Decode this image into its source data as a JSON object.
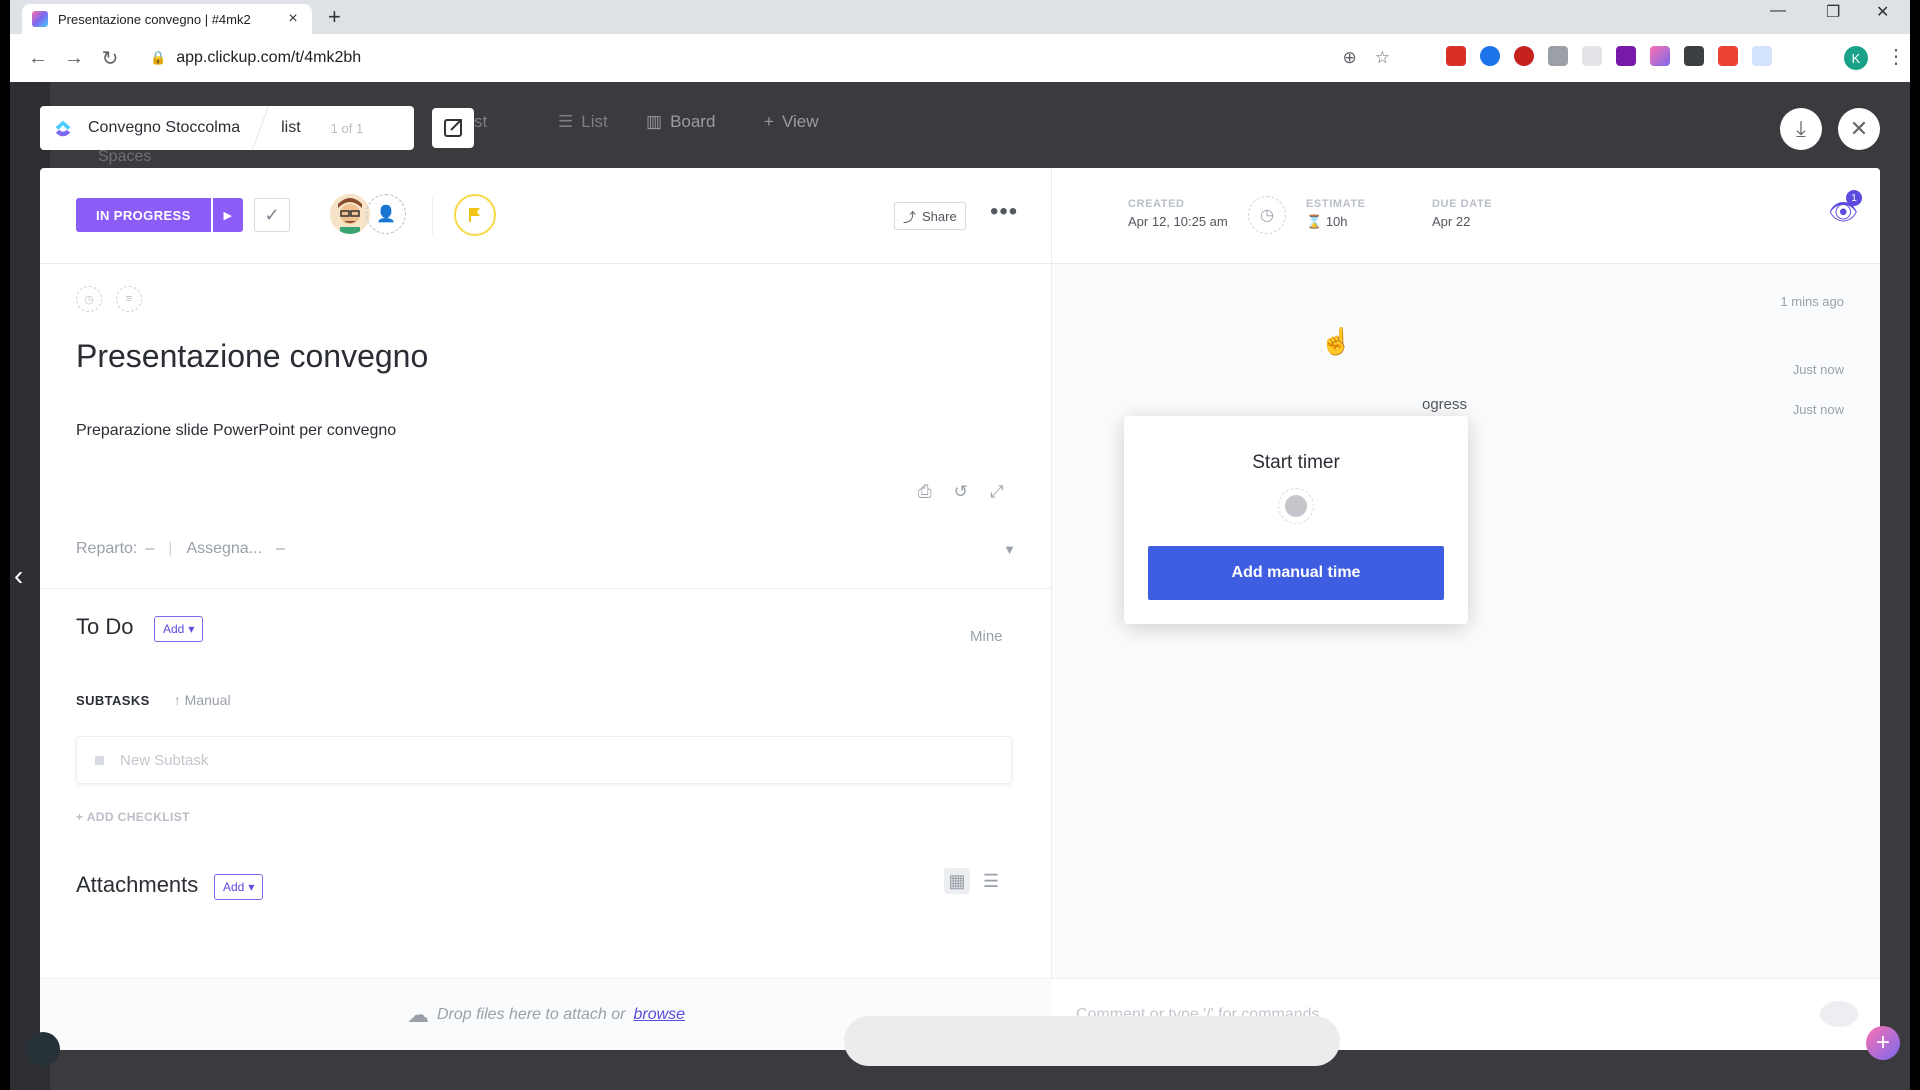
{
  "browser": {
    "tab_title": "Presentazione convegno | #4mk2",
    "tab_close": "×",
    "new_tab": "+",
    "url": "app.clickup.com/t/4mk2bh",
    "profile_initial": "K",
    "window_min": "—",
    "window_restore": "❐",
    "window_close": "✕"
  },
  "background": {
    "nav_list": "st",
    "nav_list_view": "List",
    "nav_board": "Board",
    "nav_view": "View",
    "spaces_label": "Spaces"
  },
  "breadcrumb": {
    "space": "Convegno Stoccolma",
    "list": "list",
    "count": "1 of 1"
  },
  "task": {
    "status": "IN PROGRESS",
    "share_label": "Share",
    "title": "Presentazione convegno",
    "description": "Preparazione slide PowerPoint per convegno",
    "field_reparto_label": "Reparto:",
    "field_reparto_value": "–",
    "field_assegna_label": "Assegna...",
    "field_assegna_value": "–",
    "todo_title": "To Do",
    "add_label": "Add",
    "mine_label": "Mine",
    "subtasks_label": "SUBTASKS",
    "subtasks_sort": "Manual",
    "new_subtask_placeholder": "New Subtask",
    "add_checklist": "+ ADD CHECKLIST",
    "attachments_title": "Attachments",
    "drop_text": "Drop files here to attach or",
    "browse_link": "browse"
  },
  "meta": {
    "created_label": "CREATED",
    "created_value": "Apr 12, 10:25 am",
    "estimate_label": "ESTIMATE",
    "estimate_value": "10h",
    "due_label": "DUE DATE",
    "due_value": "Apr 22",
    "watchers_count": "1"
  },
  "activity": {
    "time_1": "1 mins ago",
    "time_2": "Just now",
    "time_3": "Just now",
    "partial_text": "ogress"
  },
  "comment": {
    "placeholder": "Comment or type '/' for commands"
  },
  "timer_popover": {
    "title": "Start timer",
    "button": "Add manual time"
  },
  "colors": {
    "status": "#8b5cf6",
    "primary_button": "#3f5de0",
    "accent": "#7b68ee",
    "flag": "#f8d94a"
  }
}
